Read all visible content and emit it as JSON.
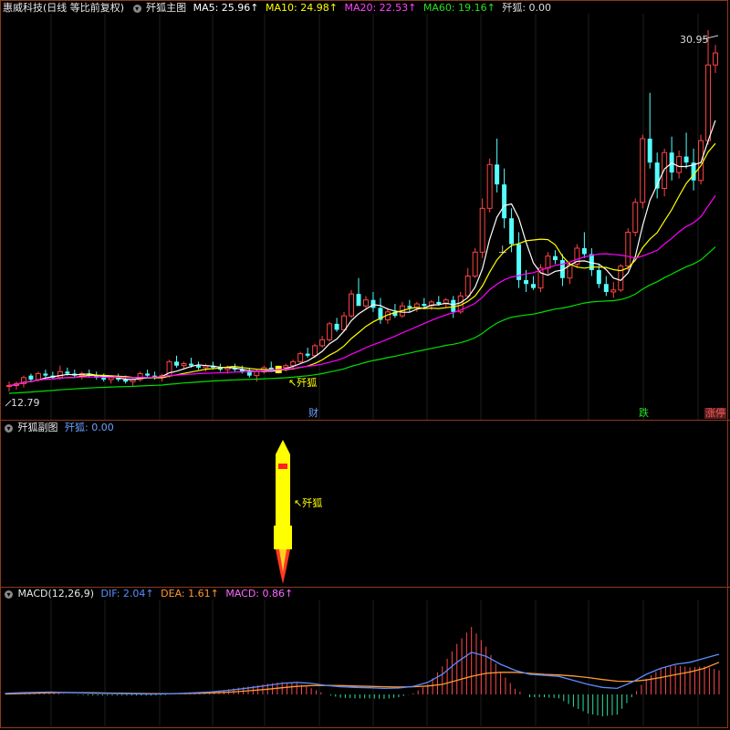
{
  "main_header": {
    "stock": "惠威科技(日线 等比前复权)",
    "indicator": "歼狐主图",
    "ma5_label": "MA5: 25.96↑",
    "ma10_label": "MA10: 24.98↑",
    "ma20_label": "MA20: 22.53↑",
    "ma60_label": "MA60: 19.16↑",
    "signal_label": "歼狐: 0.00"
  },
  "sub_header": {
    "indicator": "歼狐副图",
    "signal_label": "歼狐: 0.00"
  },
  "macd_header": {
    "indicator": "MACD(12,26,9)",
    "dif_label": "DIF: 2.04↑",
    "dea_label": "DEA: 1.61↑",
    "macd_label": "MACD: 0.86↑"
  },
  "annotations": {
    "high_price": "30.95",
    "low_price": "12.79",
    "signal_arrow_main": "↖歼狐",
    "signal_arrow_sub": "↖歼狐",
    "top_marker": "⊥",
    "event_cai": "财",
    "event_die": "跌",
    "event_zhangting": "涨停"
  },
  "colors": {
    "up": "#ff4444",
    "down": "#54ffff",
    "ma5": "#ffffff",
    "ma10": "#ffff00",
    "ma20": "#ff00ff",
    "ma60": "#00e000",
    "dif": "#5b8cff",
    "dea": "#ff9933",
    "border": "#8b3a1a"
  },
  "chart_data": [
    {
      "type": "candlestick",
      "title": "惠威科技(日线 等比前复权)",
      "ylim": [
        12.3,
        31.5
      ],
      "candles": [
        [
          13.1,
          13.3,
          12.8,
          13.1
        ],
        [
          13.1,
          13.3,
          12.9,
          13.2
        ],
        [
          13.2,
          13.6,
          13.0,
          13.5
        ],
        [
          13.6,
          13.7,
          13.3,
          13.4
        ],
        [
          13.4,
          13.8,
          13.3,
          13.7
        ],
        [
          13.7,
          13.9,
          13.5,
          13.6
        ],
        [
          13.6,
          13.8,
          13.4,
          13.5
        ],
        [
          13.5,
          14.1,
          13.4,
          13.8
        ],
        [
          13.8,
          14.0,
          13.6,
          13.7
        ],
        [
          13.7,
          13.9,
          13.5,
          13.6
        ],
        [
          13.6,
          13.8,
          13.4,
          13.7
        ],
        [
          13.7,
          13.9,
          13.5,
          13.6
        ],
        [
          13.6,
          13.8,
          13.4,
          13.5
        ],
        [
          13.5,
          13.7,
          13.3,
          13.4
        ],
        [
          13.4,
          13.6,
          13.2,
          13.5
        ],
        [
          13.5,
          13.7,
          13.3,
          13.4
        ],
        [
          13.4,
          13.6,
          13.2,
          13.3
        ],
        [
          13.3,
          13.5,
          13.1,
          13.4
        ],
        [
          13.4,
          13.8,
          13.3,
          13.7
        ],
        [
          13.7,
          13.9,
          13.5,
          13.6
        ],
        [
          13.6,
          13.8,
          13.4,
          13.5
        ],
        [
          13.5,
          13.7,
          13.3,
          13.6
        ],
        [
          13.6,
          14.4,
          13.5,
          14.3
        ],
        [
          14.3,
          14.6,
          14.0,
          14.1
        ],
        [
          14.1,
          14.3,
          13.9,
          14.2
        ],
        [
          14.2,
          14.5,
          14.0,
          14.1
        ],
        [
          14.1,
          14.3,
          13.9,
          14.0
        ],
        [
          14.0,
          14.2,
          13.8,
          14.1
        ],
        [
          14.1,
          14.3,
          13.9,
          14.0
        ],
        [
          14.0,
          14.2,
          13.8,
          13.9
        ],
        [
          13.9,
          14.1,
          13.7,
          14.0
        ],
        [
          14.0,
          14.2,
          13.8,
          13.9
        ],
        [
          13.9,
          14.1,
          13.7,
          13.8
        ],
        [
          13.8,
          14.0,
          13.5,
          13.6
        ],
        [
          13.6,
          13.9,
          13.3,
          13.8
        ],
        [
          13.8,
          14.1,
          13.7,
          14.0
        ],
        [
          14.0,
          14.3,
          13.8,
          13.9
        ],
        [
          13.9,
          14.1,
          13.7,
          14.0
        ],
        [
          14.0,
          14.2,
          13.8,
          14.1
        ],
        [
          14.1,
          14.4,
          13.9,
          14.3
        ],
        [
          14.3,
          14.8,
          14.2,
          14.7
        ],
        [
          14.7,
          15.0,
          14.5,
          14.6
        ],
        [
          14.6,
          15.2,
          14.5,
          15.1
        ],
        [
          15.1,
          15.6,
          15.0,
          15.4
        ],
        [
          15.4,
          16.3,
          15.3,
          16.2
        ],
        [
          16.2,
          16.5,
          15.8,
          15.9
        ],
        [
          15.9,
          16.8,
          15.8,
          16.6
        ],
        [
          16.6,
          17.9,
          16.5,
          17.7
        ],
        [
          17.7,
          18.5,
          17.4,
          17.1
        ],
        [
          17.1,
          17.6,
          16.9,
          17.4
        ],
        [
          17.4,
          17.8,
          16.8,
          17.0
        ],
        [
          17.0,
          17.5,
          16.2,
          16.4
        ],
        [
          16.4,
          17.0,
          16.2,
          16.8
        ],
        [
          16.8,
          17.2,
          16.5,
          16.6
        ],
        [
          16.6,
          17.3,
          16.5,
          17.1
        ],
        [
          17.1,
          17.4,
          16.8,
          17.0
        ],
        [
          17.0,
          17.3,
          16.8,
          17.2
        ],
        [
          17.2,
          17.5,
          17.0,
          17.1
        ],
        [
          17.1,
          17.4,
          16.9,
          17.3
        ],
        [
          17.3,
          17.6,
          17.1,
          17.2
        ],
        [
          17.2,
          17.5,
          17.0,
          17.4
        ],
        [
          17.4,
          17.6,
          16.5,
          16.8
        ],
        [
          16.8,
          17.8,
          16.7,
          17.6
        ],
        [
          17.6,
          19.0,
          17.5,
          18.6
        ],
        [
          18.6,
          20.0,
          18.5,
          19.8
        ],
        [
          19.8,
          22.5,
          19.5,
          22.0
        ],
        [
          22.0,
          24.5,
          21.8,
          24.2
        ],
        [
          24.2,
          25.5,
          22.8,
          23.2
        ],
        [
          23.2,
          24.0,
          21.0,
          21.5
        ],
        [
          21.5,
          22.0,
          19.8,
          20.2
        ],
        [
          20.2,
          20.8,
          18.0,
          18.4
        ],
        [
          18.4,
          18.9,
          17.8,
          18.2
        ],
        [
          18.2,
          18.6,
          17.9,
          18.0
        ],
        [
          18.0,
          19.2,
          17.8,
          19.0
        ],
        [
          19.0,
          19.8,
          18.7,
          19.6
        ],
        [
          19.6,
          19.9,
          19.2,
          19.4
        ],
        [
          19.4,
          19.7,
          18.1,
          18.5
        ],
        [
          18.5,
          19.3,
          18.2,
          19.2
        ],
        [
          19.2,
          20.2,
          19.0,
          20.0
        ],
        [
          20.0,
          20.8,
          19.5,
          19.7
        ],
        [
          19.7,
          20.0,
          18.6,
          18.9
        ],
        [
          18.9,
          19.2,
          18.0,
          18.2
        ],
        [
          18.2,
          18.6,
          17.6,
          17.8
        ],
        [
          17.8,
          18.3,
          17.5,
          17.9
        ],
        [
          17.9,
          19.2,
          17.8,
          19.1
        ],
        [
          19.1,
          21.0,
          18.9,
          20.8
        ],
        [
          20.8,
          22.5,
          20.6,
          22.3
        ],
        [
          22.3,
          25.7,
          22.0,
          25.5
        ],
        [
          25.5,
          27.8,
          24.0,
          24.3
        ],
        [
          24.3,
          24.8,
          22.5,
          23.0
        ],
        [
          23.0,
          25.0,
          22.6,
          24.8
        ],
        [
          24.8,
          25.6,
          23.4,
          23.8
        ],
        [
          23.8,
          24.9,
          23.5,
          24.6
        ],
        [
          24.6,
          25.8,
          24.0,
          24.3
        ],
        [
          24.3,
          25.0,
          22.9,
          23.4
        ],
        [
          23.4,
          25.7,
          23.2,
          25.4
        ],
        [
          25.4,
          30.95,
          25.2,
          29.2
        ],
        [
          29.2,
          30.2,
          28.8,
          29.8
        ]
      ],
      "ma_lines": [
        {
          "name": "MA5",
          "color": "#ffffff",
          "value": 25.96
        },
        {
          "name": "MA10",
          "color": "#ffff00",
          "value": 24.98
        },
        {
          "name": "MA20",
          "color": "#ff00ff",
          "value": 22.53
        },
        {
          "name": "MA60",
          "color": "#00e000",
          "value": 19.16
        }
      ],
      "signal_index": 37
    },
    {
      "type": "line",
      "title": "MACD(12,26,9)",
      "series": [
        {
          "name": "DIF",
          "values": [
            0.05,
            0.08,
            0.1,
            0.12,
            0.1,
            0.08,
            0.06,
            0.05,
            0.04,
            0.03,
            0.02,
            0.03,
            0.05,
            0.08,
            0.12,
            0.18,
            0.26,
            0.35,
            0.45,
            0.55,
            0.6,
            0.55,
            0.45,
            0.38,
            0.35,
            0.33,
            0.3,
            0.32,
            0.4,
            0.6,
            1.0,
            1.6,
            2.1,
            1.9,
            1.5,
            1.2,
            1.0,
            0.95,
            0.9,
            0.7,
            0.5,
            0.35,
            0.3,
            0.6,
            1.0,
            1.3,
            1.5,
            1.6,
            1.8,
            2.0
          ]
        },
        {
          "name": "DEA",
          "values": [
            0.02,
            0.04,
            0.06,
            0.08,
            0.09,
            0.09,
            0.08,
            0.07,
            0.06,
            0.05,
            0.04,
            0.04,
            0.04,
            0.05,
            0.07,
            0.1,
            0.14,
            0.2,
            0.26,
            0.33,
            0.4,
            0.44,
            0.45,
            0.44,
            0.42,
            0.4,
            0.38,
            0.37,
            0.38,
            0.42,
            0.5,
            0.7,
            0.9,
            1.05,
            1.1,
            1.1,
            1.05,
            1.0,
            0.97,
            0.92,
            0.84,
            0.74,
            0.66,
            0.65,
            0.72,
            0.84,
            0.98,
            1.12,
            1.3,
            1.6
          ]
        },
        {
          "name": "MACD",
          "values": [
            0.06,
            0.08,
            0.08,
            0.08,
            0.02,
            -0.02,
            -0.04,
            -0.04,
            -0.04,
            -0.04,
            -0.04,
            -0.02,
            0.02,
            0.06,
            0.1,
            0.16,
            0.24,
            0.3,
            0.38,
            0.44,
            0.4,
            0.22,
            0.0,
            -0.12,
            -0.14,
            -0.14,
            -0.16,
            -0.1,
            0.04,
            0.36,
            1.0,
            1.8,
            2.4,
            1.7,
            0.8,
            0.2,
            -0.1,
            -0.1,
            -0.14,
            -0.44,
            -0.68,
            -0.78,
            -0.72,
            -0.1,
            0.56,
            0.92,
            1.04,
            0.96,
            1.0,
            0.86
          ]
        }
      ]
    }
  ]
}
